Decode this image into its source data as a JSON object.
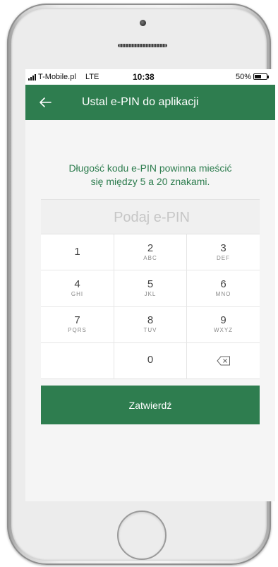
{
  "status_bar": {
    "carrier": "T-Mobile.pl",
    "network": "LTE",
    "time": "10:38",
    "battery": "50%"
  },
  "app_bar": {
    "title": "Ustal e-PIN do aplikacji",
    "back_icon": "arrow-left-icon",
    "color": "#2e7d4f"
  },
  "info_text": {
    "line1": "Długość kodu e-PIN powinna mieścić",
    "line2": "się między 5 a 20 znakami."
  },
  "pin_input": {
    "placeholder": "Podaj e-PIN",
    "value": ""
  },
  "keypad": {
    "keys": [
      {
        "digit": "1",
        "letters": ""
      },
      {
        "digit": "2",
        "letters": "ABC"
      },
      {
        "digit": "3",
        "letters": "DEF"
      },
      {
        "digit": "4",
        "letters": "GHI"
      },
      {
        "digit": "5",
        "letters": "JKL"
      },
      {
        "digit": "6",
        "letters": "MNO"
      },
      {
        "digit": "7",
        "letters": "PQRS"
      },
      {
        "digit": "8",
        "letters": "TUV"
      },
      {
        "digit": "9",
        "letters": "WXYZ"
      },
      {
        "digit": "0",
        "letters": ""
      }
    ],
    "backspace_icon": "backspace-icon"
  },
  "confirm_button": {
    "label": "Zatwierdź",
    "color": "#2e7d4f"
  }
}
